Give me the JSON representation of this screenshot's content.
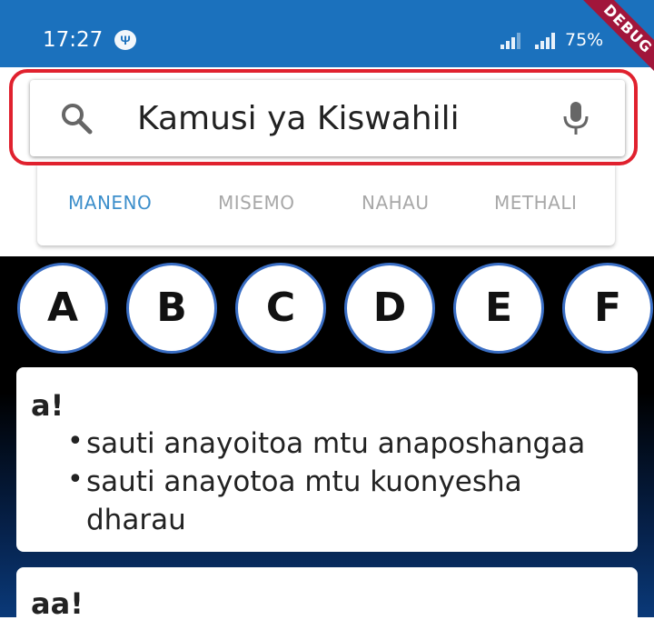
{
  "status_bar": {
    "time": "17:27",
    "battery": "75%",
    "usb_symbol": "Ψ"
  },
  "debug_banner": "DEBUG",
  "search": {
    "title": "Kamusi ya Kiswahili"
  },
  "tabs": [
    {
      "label": "MANENO",
      "active": true
    },
    {
      "label": "MISEMO",
      "active": false
    },
    {
      "label": "NAHAU",
      "active": false
    },
    {
      "label": "METHALI",
      "active": false
    }
  ],
  "letters": [
    "A",
    "B",
    "C",
    "D",
    "E",
    "F"
  ],
  "entries": [
    {
      "word": "a!",
      "definitions": [
        "sauti anayoitoa mtu anaposhangaa",
        "sauti anayotoa mtu kuonyesha dharau"
      ]
    },
    {
      "word": "aa!",
      "definitions": []
    }
  ],
  "bullet": "•",
  "colors": {
    "primary": "#1b71bd",
    "highlight": "#e0212e",
    "active_tab": "#3d8fcb",
    "letter_border": "#3a6ec4",
    "debug": "#a1163b"
  }
}
